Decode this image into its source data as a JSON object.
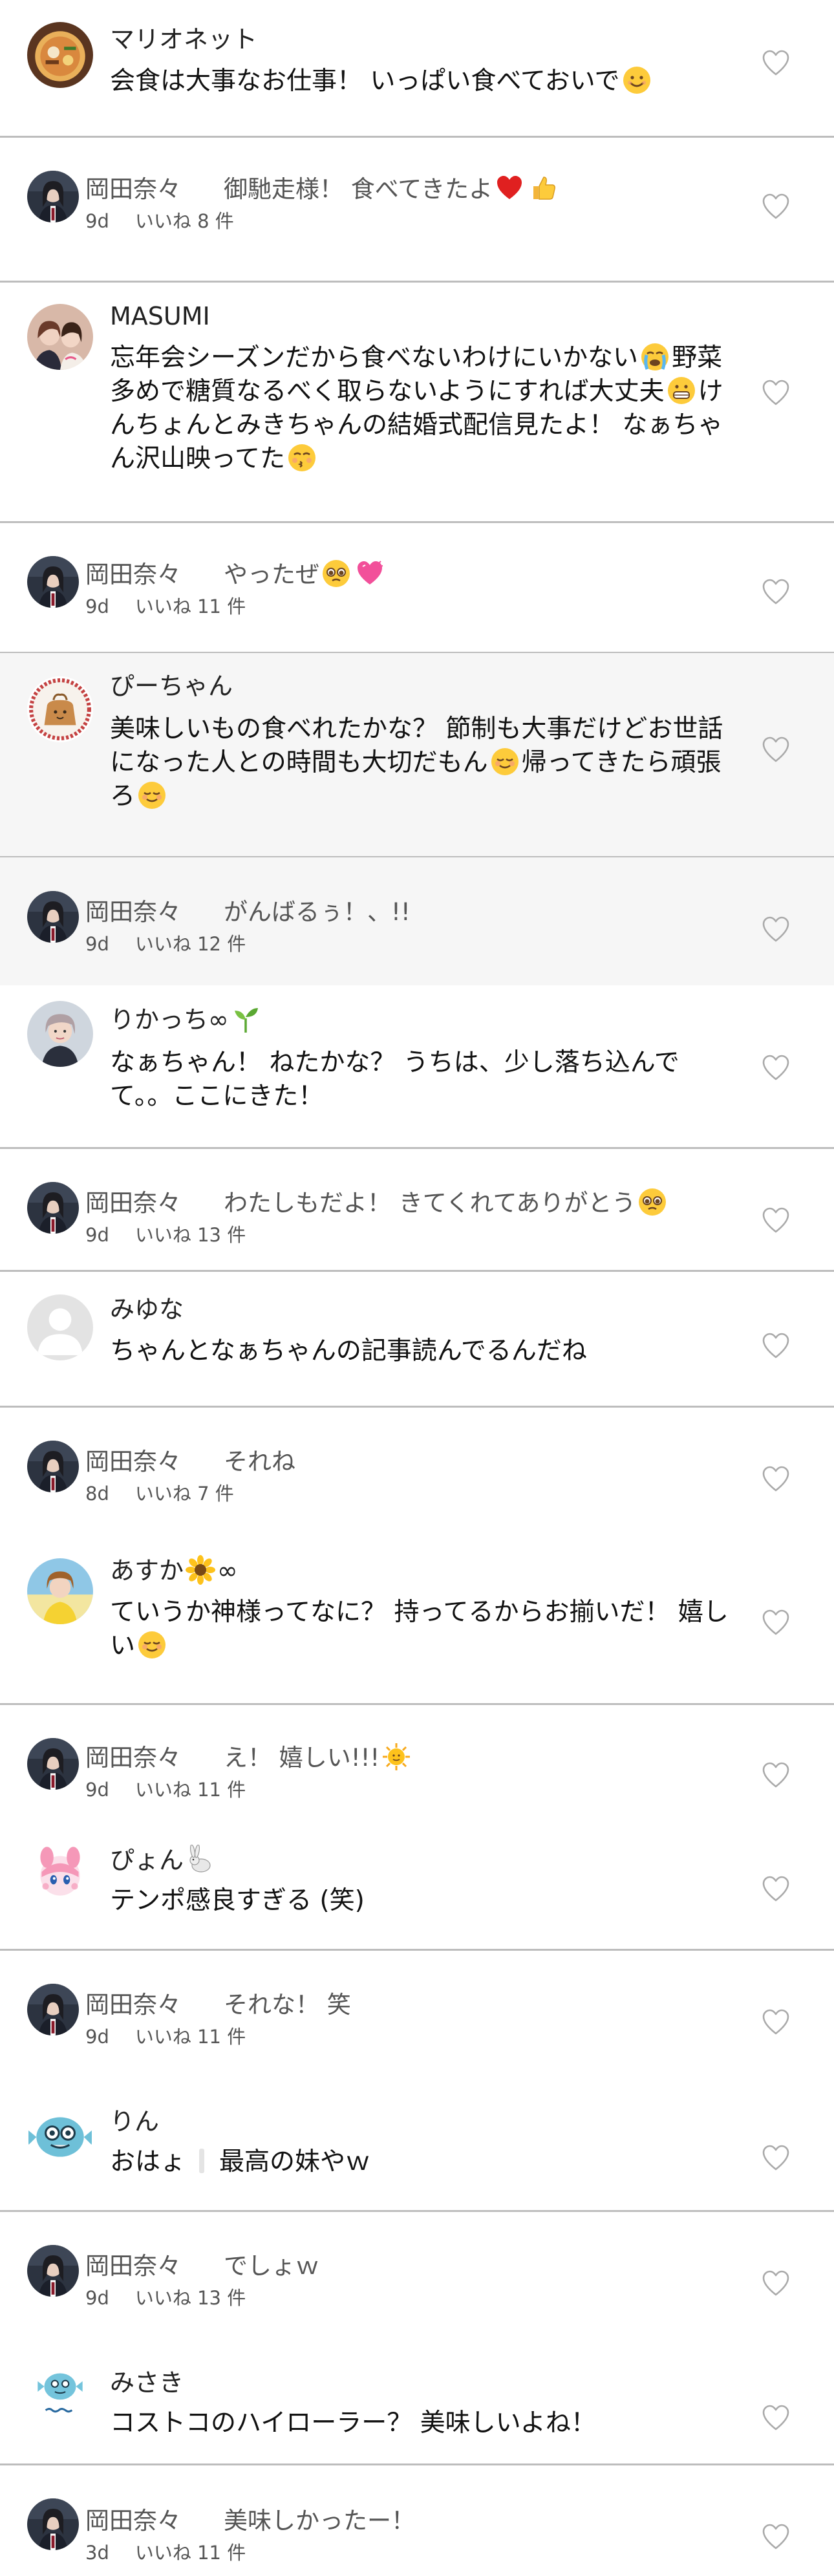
{
  "entries": [
    {
      "kind": "comment",
      "avatar": "ramen",
      "name": "マリオネット",
      "lines": [
        [
          {
            "t": "会食は大事なお仕事！ いっぱい食べておいで"
          },
          {
            "e": "smile"
          }
        ]
      ]
    },
    {
      "kind": "reply",
      "name": "岡田奈々",
      "text": [
        {
          "t": "御馳走様！ 食べてきたよ"
        },
        {
          "e": "red-heart"
        },
        {
          "e": "thumbs-up"
        }
      ],
      "time": "9d",
      "likes": "いいね 8 件"
    },
    {
      "kind": "comment",
      "avatar": "duo",
      "name": "MASUMI",
      "lines": [
        [
          {
            "t": "忘年会シーズンだから食べないわけにいかない"
          },
          {
            "e": "cry"
          },
          {
            "t": "野菜"
          }
        ],
        [
          {
            "t": "多めで糖質なるべく取らないようにすれば大丈夫"
          },
          {
            "e": "grin"
          },
          {
            "t": "け"
          }
        ],
        [
          {
            "t": "んちょんとみきちゃんの結婚式配信見たよ！ なぁちゃ"
          }
        ],
        [
          {
            "t": "ん沢山映ってた"
          },
          {
            "e": "kiss"
          }
        ]
      ]
    },
    {
      "kind": "reply",
      "name": "岡田奈々",
      "text": [
        {
          "t": "やったぜ"
        },
        {
          "e": "plead"
        },
        {
          "e": "pink-heart"
        }
      ],
      "time": "9d",
      "likes": "いいね 11 件"
    },
    {
      "kind": "comment",
      "avatar": "bag",
      "tinted": true,
      "name": "ぴーちゃん",
      "lines": [
        [
          {
            "t": "美味しいもの食べれたかな？ 節制も大事だけどお世話"
          }
        ],
        [
          {
            "t": "になった人との時間も大切だもん"
          },
          {
            "e": "relaxed"
          },
          {
            "t": "帰ってきたら頑張"
          }
        ],
        [
          {
            "t": "ろ"
          },
          {
            "e": "relaxed"
          }
        ]
      ]
    },
    {
      "kind": "reply",
      "tinted": true,
      "name": "岡田奈々",
      "text": [
        {
          "t": "がんばるぅ！、!!"
        }
      ],
      "time": "9d",
      "likes": "いいね 12 件"
    },
    {
      "kind": "comment",
      "avatar": "girl",
      "name": "りかっち∞",
      "name_emoji": "seedling",
      "lines": [
        [
          {
            "t": "なぁちゃん！ ねたかな？ うちは、少し落ち込んで"
          }
        ],
        [
          {
            "t": "て。。ここにきた！"
          }
        ]
      ]
    },
    {
      "kind": "reply",
      "name": "岡田奈々",
      "text": [
        {
          "t": "わたしもだよ！ きてくれてありがとう"
        },
        {
          "e": "plead"
        }
      ],
      "time": "9d",
      "likes": "いいね 13 件"
    },
    {
      "kind": "comment",
      "avatar": "default",
      "name": "みゆな",
      "lines": [
        [
          {
            "t": "ちゃんとなぁちゃんの記事読んでるんだね"
          }
        ]
      ]
    },
    {
      "kind": "reply",
      "name": "岡田奈々",
      "text": [
        {
          "t": "それね"
        }
      ],
      "time": "8d",
      "likes": "いいね 7 件"
    },
    {
      "kind": "comment",
      "avatar": "yellow",
      "name": "あすか",
      "name_emoji": "sunflower",
      "name_suffix": "∞",
      "lines": [
        [
          {
            "t": "ていうか神様ってなに？ 持ってるからお揃いだ！ 嬉し"
          }
        ],
        [
          {
            "t": "い"
          },
          {
            "e": "relaxed"
          }
        ]
      ]
    },
    {
      "kind": "reply",
      "name": "岡田奈々",
      "text": [
        {
          "t": "え！ 嬉しい!!!"
        },
        {
          "e": "sun-face"
        }
      ],
      "time": "9d",
      "likes": "いいね 11 件"
    },
    {
      "kind": "comment",
      "avatar": "pink",
      "name": "ぴょん",
      "name_emoji": "rabbit",
      "lines": [
        [
          {
            "t": "テンポ感良すぎる (笑)"
          }
        ]
      ]
    },
    {
      "kind": "reply",
      "name": "岡田奈々",
      "text": [
        {
          "t": "それな！ 笑"
        }
      ],
      "time": "9d",
      "likes": "いいね 11 件"
    },
    {
      "kind": "comment",
      "avatar": "fish",
      "name": "りん",
      "lines": [
        [
          {
            "t": "おはょ"
          },
          {
            "e": "gray-mark"
          },
          {
            "t": "最高の妹やｗ"
          }
        ]
      ]
    },
    {
      "kind": "reply",
      "name": "岡田奈々",
      "text": [
        {
          "t": "でしょｗ"
        }
      ],
      "time": "9d",
      "likes": "いいね 13 件"
    },
    {
      "kind": "comment",
      "avatar": "fish2",
      "name": "みさき",
      "lines": [
        [
          {
            "t": "コストコのハイローラー？ 美味しいよね！"
          }
        ]
      ]
    },
    {
      "kind": "reply",
      "name": "岡田奈々",
      "text": [
        {
          "t": "美味しかったー！"
        }
      ],
      "time": "3d",
      "likes": "いいね 11 件"
    }
  ],
  "colors": {
    "divider": "#bdbdbd",
    "text": "#111111",
    "meta": "#555555",
    "tint": "#f6f6f6",
    "heart_outline": "#aaaaaa"
  }
}
